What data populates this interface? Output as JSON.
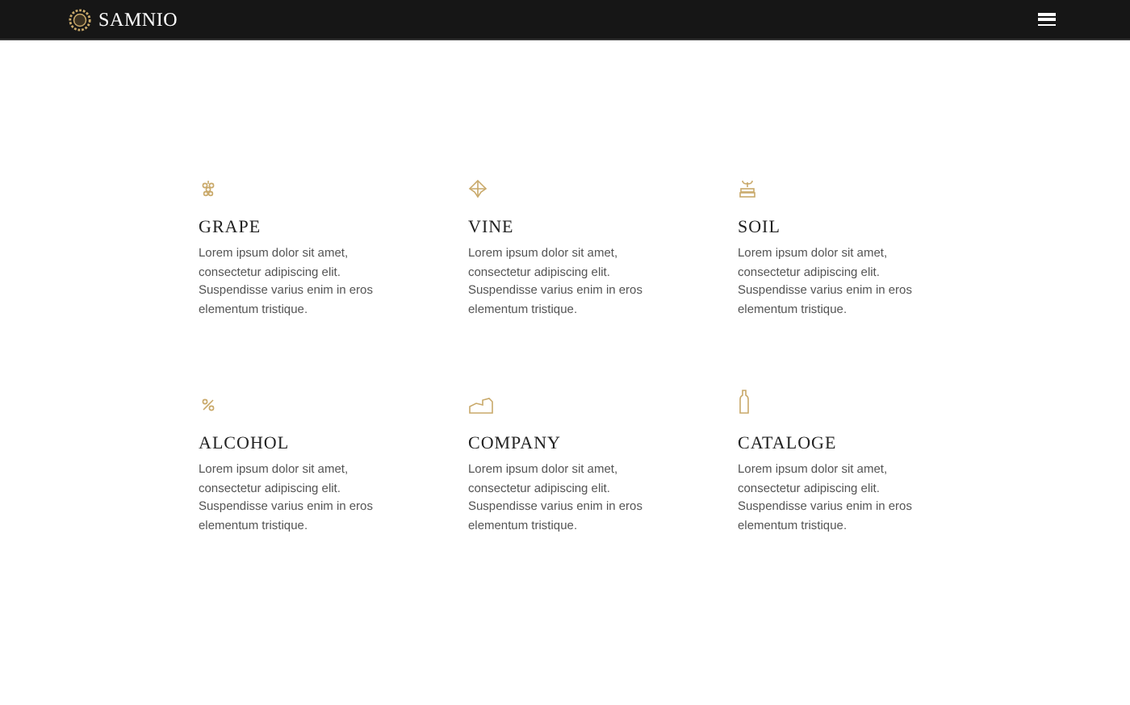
{
  "header": {
    "brand": "SAMNIO"
  },
  "features": [
    {
      "kind": "grape",
      "title": "GRAPE",
      "text": "Lorem ipsum dolor sit amet, consectetur adipiscing elit. Suspendisse varius enim in eros elementum tristique."
    },
    {
      "kind": "vine",
      "title": "VINE",
      "text": "Lorem ipsum dolor sit amet, consectetur adipiscing elit. Suspendisse varius enim in eros elementum tristique."
    },
    {
      "kind": "soil",
      "title": "SOIL",
      "text": "Lorem ipsum dolor sit amet, consectetur adipiscing elit. Suspendisse varius enim in eros elementum tristique."
    },
    {
      "kind": "alcohol",
      "title": "ALCOHOL",
      "text": "Lorem ipsum dolor sit amet, consectetur adipiscing elit. Suspendisse varius enim in eros elementum tristique."
    },
    {
      "kind": "company",
      "title": "COMPANY",
      "text": "Lorem ipsum dolor sit amet, consectetur adipiscing elit. Suspendisse varius enim in eros elementum tristique."
    },
    {
      "kind": "cataloge",
      "title": "CATALOGE",
      "text": "Lorem ipsum dolor sit amet, consectetur adipiscing elit. Suspendisse varius enim in eros elementum tristique."
    }
  ]
}
